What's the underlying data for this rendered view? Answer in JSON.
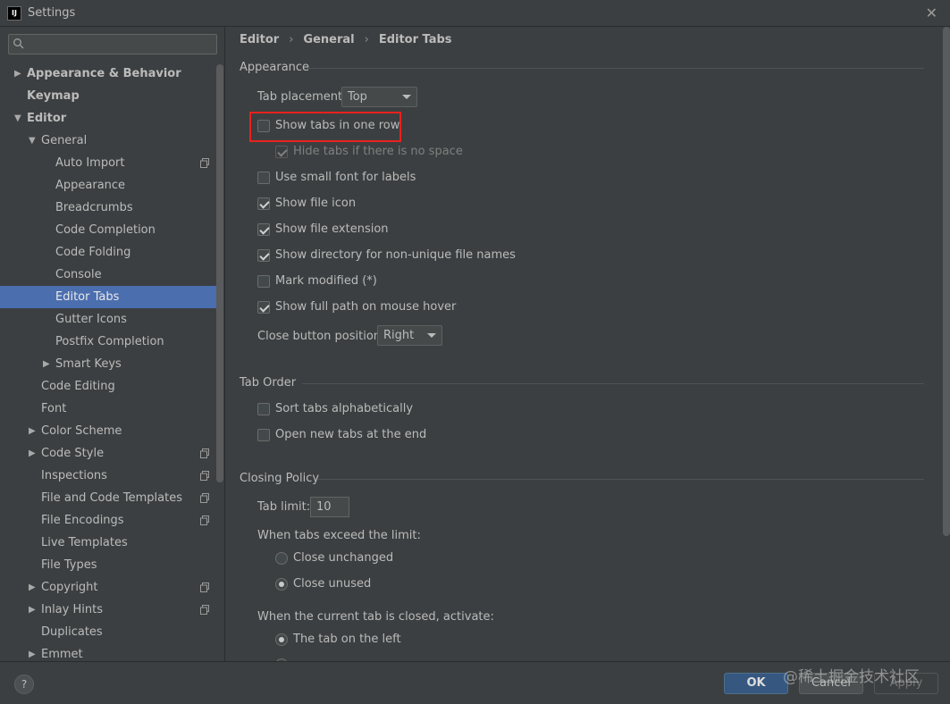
{
  "window": {
    "title": "Settings",
    "logo": "IJ"
  },
  "search": {
    "placeholder": ""
  },
  "tree": [
    {
      "label": "Appearance & Behavior",
      "arrow": "right",
      "bold": true
    },
    {
      "label": "Keymap",
      "bold": true
    },
    {
      "label": "Editor",
      "arrow": "down",
      "bold": true
    },
    {
      "label": "General",
      "arrow": "down"
    },
    {
      "label": "Auto Import",
      "copy": true
    },
    {
      "label": "Appearance"
    },
    {
      "label": "Breadcrumbs"
    },
    {
      "label": "Code Completion"
    },
    {
      "label": "Code Folding"
    },
    {
      "label": "Console"
    },
    {
      "label": "Editor Tabs",
      "selected": true
    },
    {
      "label": "Gutter Icons"
    },
    {
      "label": "Postfix Completion"
    },
    {
      "label": "Smart Keys",
      "arrow": "right"
    },
    {
      "label": "Code Editing"
    },
    {
      "label": "Font"
    },
    {
      "label": "Color Scheme",
      "arrow": "right"
    },
    {
      "label": "Code Style",
      "arrow": "right",
      "copy": true
    },
    {
      "label": "Inspections",
      "copy": true
    },
    {
      "label": "File and Code Templates",
      "copy": true
    },
    {
      "label": "File Encodings",
      "copy": true
    },
    {
      "label": "Live Templates"
    },
    {
      "label": "File Types"
    },
    {
      "label": "Copyright",
      "arrow": "right",
      "copy": true
    },
    {
      "label": "Inlay Hints",
      "arrow": "right",
      "copy": true
    },
    {
      "label": "Duplicates"
    },
    {
      "label": "Emmet",
      "arrow": "right"
    }
  ],
  "breadcrumb": {
    "part1": "Editor",
    "part2": "General",
    "part3": "Editor Tabs",
    "sep": "›"
  },
  "appearance": {
    "title": "Appearance",
    "tab_placement_label": "Tab placement:",
    "tab_placement_value": "Top",
    "show_tabs_one_row": {
      "label": "Show tabs in one row",
      "checked": false
    },
    "hide_tabs_no_space": {
      "label": "Hide tabs if there is no space",
      "checked": true,
      "disabled": true
    },
    "small_font": {
      "label": "Use small font for labels",
      "checked": false
    },
    "file_icon": {
      "label": "Show file icon",
      "checked": true
    },
    "file_extension": {
      "label": "Show file extension",
      "checked": true
    },
    "directory": {
      "label": "Show directory for non-unique file names",
      "checked": true
    },
    "mark_modified": {
      "label": "Mark modified (*)",
      "checked": false
    },
    "full_path": {
      "label": "Show full path on mouse hover",
      "checked": true
    },
    "close_btn_label": "Close button position:",
    "close_btn_value": "Right"
  },
  "tab_order": {
    "title": "Tab Order",
    "sort_alpha": {
      "label": "Sort tabs alphabetically",
      "checked": false
    },
    "open_at_end": {
      "label": "Open new tabs at the end",
      "checked": false
    }
  },
  "closing_policy": {
    "title": "Closing Policy",
    "tab_limit_label": "Tab limit:",
    "tab_limit_value": "10",
    "exceed_label": "When tabs exceed the limit:",
    "close_unchanged": "Close unchanged",
    "close_unused": "Close unused",
    "activate_label": "When the current tab is closed, activate:",
    "tab_on_left": "The tab on the left"
  },
  "footer": {
    "help": "?",
    "ok": "OK",
    "cancel": "Cancel",
    "apply": "Apply"
  },
  "watermark": "@稀土掘金技术社区",
  "colors": {
    "selection": "#4b6eaf",
    "highlight_box": "#e8221d",
    "ok_button": "#365880"
  }
}
